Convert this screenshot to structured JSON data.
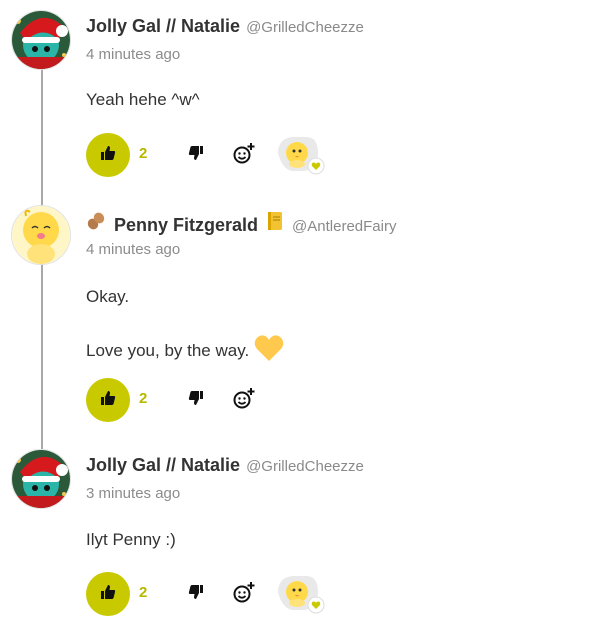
{
  "comments": [
    {
      "author": "Jolly Gal // Natalie",
      "handle": "@GrilledCheezze",
      "timestamp": "4 minutes ago",
      "body": [
        "Yeah hehe ^w^"
      ],
      "likes": "2",
      "has_reaction": true
    },
    {
      "author": "Penny Fitzgerald",
      "handle": "@AntleredFairy",
      "timestamp": "4 minutes ago",
      "body": [
        "Okay.",
        "Love you, by the way."
      ],
      "likes": "2",
      "has_reaction": false
    },
    {
      "author": "Jolly Gal // Natalie",
      "handle": "@GrilledCheezze",
      "timestamp": "3 minutes ago",
      "body": [
        "Ilyt Penny :)"
      ],
      "likes": "2",
      "has_reaction": true
    }
  ],
  "icons": {
    "like": "thumbs-up-icon",
    "dislike": "thumbs-down-icon",
    "react": "add-reaction-icon",
    "reaction": "chick-sticker-icon",
    "heart": "heart-icon",
    "name_badge_left": "peanut-icon",
    "name_badge_right": "notebook-icon"
  },
  "colors": {
    "accent": "#c9c900",
    "accent_text": "#b8b800",
    "heart": "#ffc94d",
    "reaction_badge": "#c9c900"
  }
}
